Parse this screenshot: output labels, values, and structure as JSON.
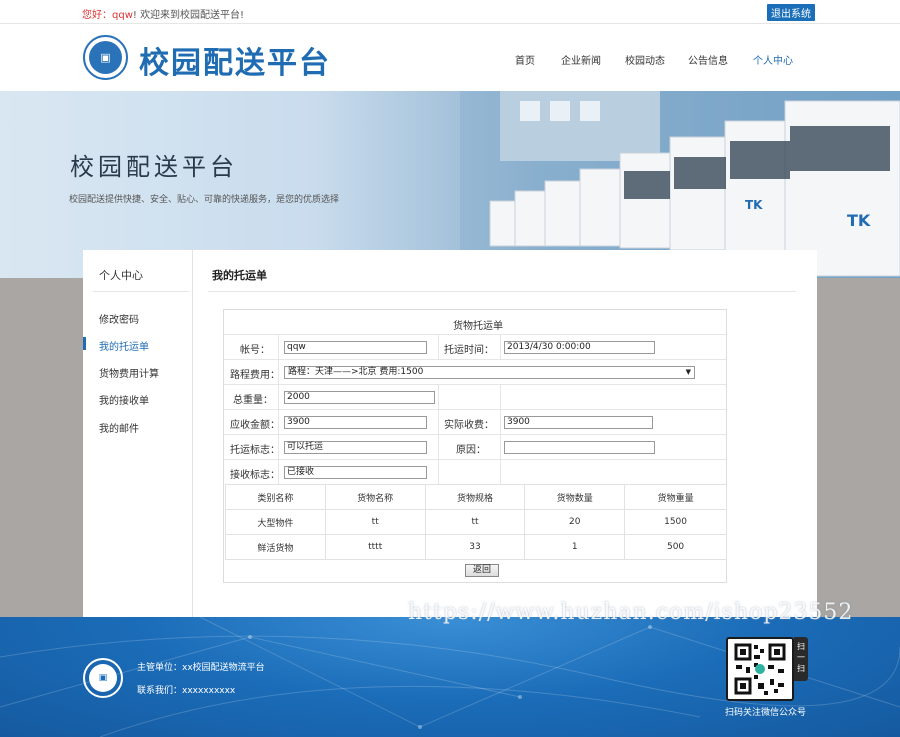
{
  "topbar": {
    "greet_prefix": "您好：",
    "username": "qqw",
    "greet_suffix": "! 欢迎来到校园配送平台!",
    "logout": "退出系统"
  },
  "header": {
    "logo_text": "校园配送平台",
    "nav": [
      "首页",
      "企业新闻",
      "校园动态",
      "公告信息",
      "个人中心"
    ],
    "active_nav": "个人中心",
    "brand_color": "#1f6cb3"
  },
  "banner": {
    "title": "校园配送平台",
    "subtitle": "校园配送提供快捷、安全、贴心、可靠的快递服务，是您的优质选择"
  },
  "sidebar": {
    "title": "个人中心",
    "items": [
      "修改密码",
      "我的托运单",
      "货物费用计算",
      "我的接收单",
      "我的邮件"
    ],
    "active": "我的托运单"
  },
  "main": {
    "title": "我的托运单"
  },
  "form": {
    "caption": "货物托运单",
    "account_label": "帐号：",
    "account_value": "qqw",
    "time_label": "托运时间：",
    "time_value": "2013/4/30 0:00:00",
    "route_label": "路程费用：",
    "route_value": "路程：天津——>北京 费用:1500",
    "weight_label": "总重量：",
    "weight_value": "2000",
    "receivable_label": "应收金额：",
    "receivable_value": "3900",
    "actual_label": "实际收费：",
    "actual_value": "3900",
    "ship_flag_label": "托运标志：",
    "ship_flag_value": "可以托运",
    "reason_label": "原因：",
    "reason_value": "",
    "recv_flag_label": "接收标志：",
    "recv_flag_value": "已接收"
  },
  "goods": {
    "headers": [
      "类别名称",
      "货物名称",
      "货物规格",
      "货物数量",
      "货物重量"
    ],
    "rows": [
      [
        "大型物件",
        "tt",
        "tt",
        "20",
        "1500"
      ],
      [
        "鲜活货物",
        "tttt",
        "33",
        "1",
        "500"
      ]
    ]
  },
  "back_button": "返回",
  "footer": {
    "unit": "主管单位：xx校园配送物流平台",
    "contact": "联系我们：xxxxxxxxxx",
    "qr_side": "扫一扫",
    "qr_caption": "扫码关注微信公众号"
  },
  "watermark": "https://www.huzhan.com/ishop23552"
}
